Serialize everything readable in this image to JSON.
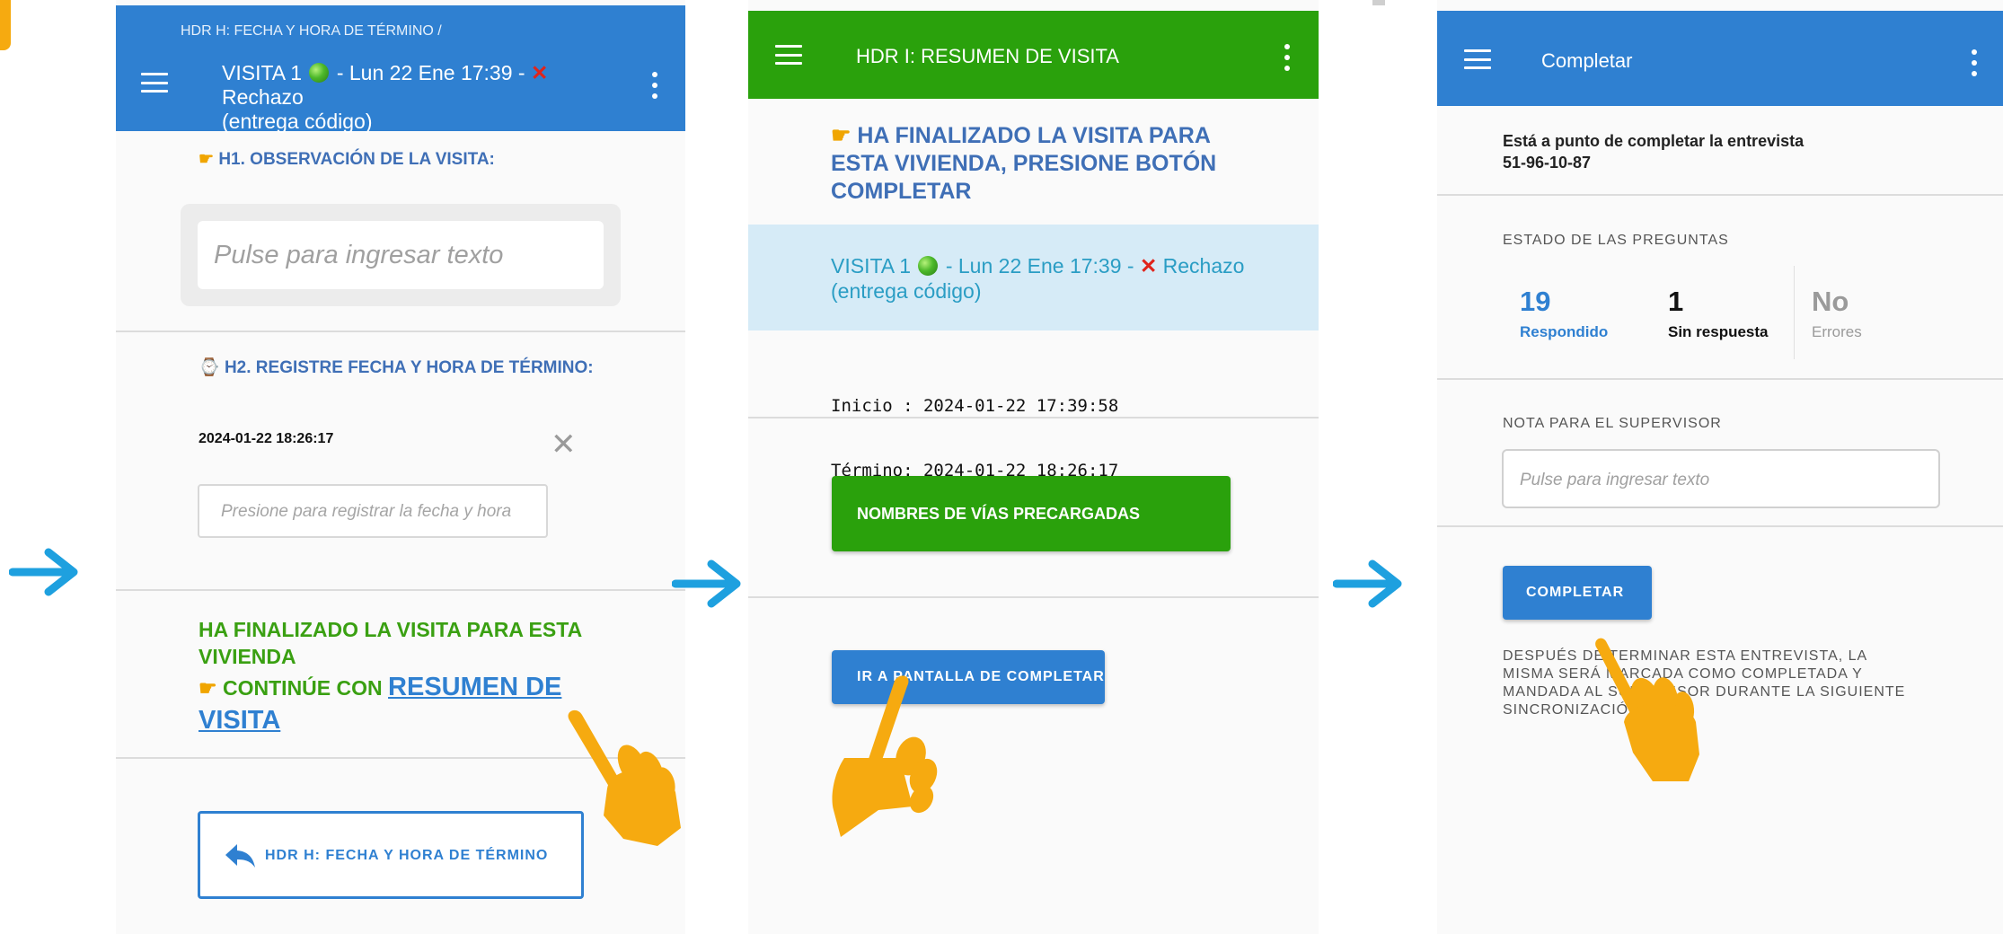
{
  "colors": {
    "blue_bar": "#2f80d1",
    "green_bar": "#2aa10c",
    "heading_blue": "#3f6fb6",
    "green_text": "#3aa012",
    "light_blue_row": "#d6ebf7",
    "teal_text": "#2a9dc4",
    "arrow": "#1ea0df",
    "hand": "#f6aa10"
  },
  "icons": {
    "menu": "hamburger-icon",
    "more": "more-vert-icon",
    "pointing": "pointing-hand-emoji",
    "watch": "watch-emoji",
    "green_circle": "green-circle-emoji",
    "cross": "cross-mark-emoji",
    "clear": "close-icon",
    "back": "reply-arrow-icon",
    "flow_arrow": "right-arrow-icon",
    "tap_hand": "tapping-hand-icon"
  },
  "panel1": {
    "breadcrumb": "HDR H: FECHA Y HORA DE TÉRMINO /",
    "title_prefix": "VISITA 1",
    "title_suffix": "- Lun 22 Ene 17:39 -",
    "title_reject": "Rechazo",
    "title_line2": "(entrega código)",
    "h1_label": "H1. OBSERVACIÓN DE LA VISITA:",
    "h1_placeholder": "Pulse para ingresar texto",
    "h2_label": "H2. REGISTRE FECHA Y HORA DE TÉRMINO:",
    "h2_value": "2024-01-22 18:26:17",
    "h2_placeholder": "Presione para registrar la fecha y hora",
    "finished_line1": "HA FINALIZADO LA VISITA PARA ESTA",
    "finished_line2": "VIVIENDA",
    "continue_text": "CONTINÚE CON",
    "continue_link_line1": "RESUMEN DE",
    "continue_link_line2": "VISITA",
    "back_button": "HDR H: FECHA Y HORA DE TÉRMINO"
  },
  "panel2": {
    "title": "HDR I: RESUMEN DE VISITA",
    "message_line1": "HA FINALIZADO LA VISITA PARA",
    "message_line2": "ESTA VIVIENDA, PRESIONE BOTÓN",
    "message_line3": "COMPLETAR",
    "visit_prefix": "VISITA 1",
    "visit_suffix": "- Lun 22 Ene 17:39 -",
    "visit_reject": "Rechazo",
    "visit_line2": "(entrega código)",
    "inicio": "Inicio : 2024-01-22 17:39:58",
    "termino": "Término: 2024-01-22 18:26:17",
    "preloaded_button": "NOMBRES DE VÍAS PRECARGADAS",
    "complete_screen_button": "IR A PANTALLA DE COMPLETAR"
  },
  "panel3": {
    "title": "Completar",
    "intro_line1": "Está a punto de completar la entrevista",
    "intro_line2": "51-96-10-87",
    "status_label": "ESTADO DE LAS PREGUNTAS",
    "answered_count": "19",
    "answered_label": "Respondido",
    "unanswered_count": "1",
    "unanswered_label": "Sin respuesta",
    "errors_count": "No",
    "errors_label": "Errores",
    "note_label": "NOTA PARA EL SUPERVISOR",
    "note_placeholder": "Pulse para ingresar texto",
    "complete_button": "COMPLETAR",
    "info_line1": "DESPUÉS DE TERMINAR ESTA ENTREVISTA, LA",
    "info_line2": "MISMA SERÁ MARCADA COMO COMPLETADA Y",
    "info_line3": "MANDADA AL SUPERVISOR DURANTE LA SIGUIENTE",
    "info_line4": "SINCRONIZACIÓN"
  }
}
